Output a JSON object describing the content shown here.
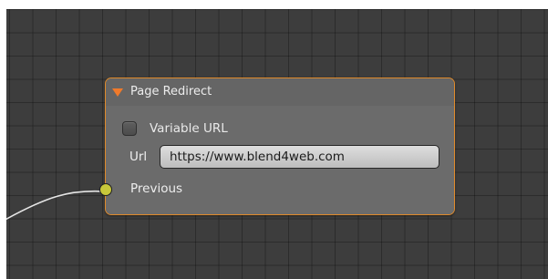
{
  "node": {
    "title": "Page Redirect",
    "variable_url_label": "Variable URL",
    "url_label": "Url",
    "url_value": "https://www.blend4web.com",
    "socket_label": "Previous"
  },
  "colors": {
    "grid_background": "#3d3d3d",
    "node_border": "#e08a2a",
    "header_arrow": "#f07a2b",
    "socket": "#c8c83a",
    "wire": "#e6e6e6"
  },
  "icons": {
    "collapse": "triangle-down",
    "socket": "circle"
  }
}
